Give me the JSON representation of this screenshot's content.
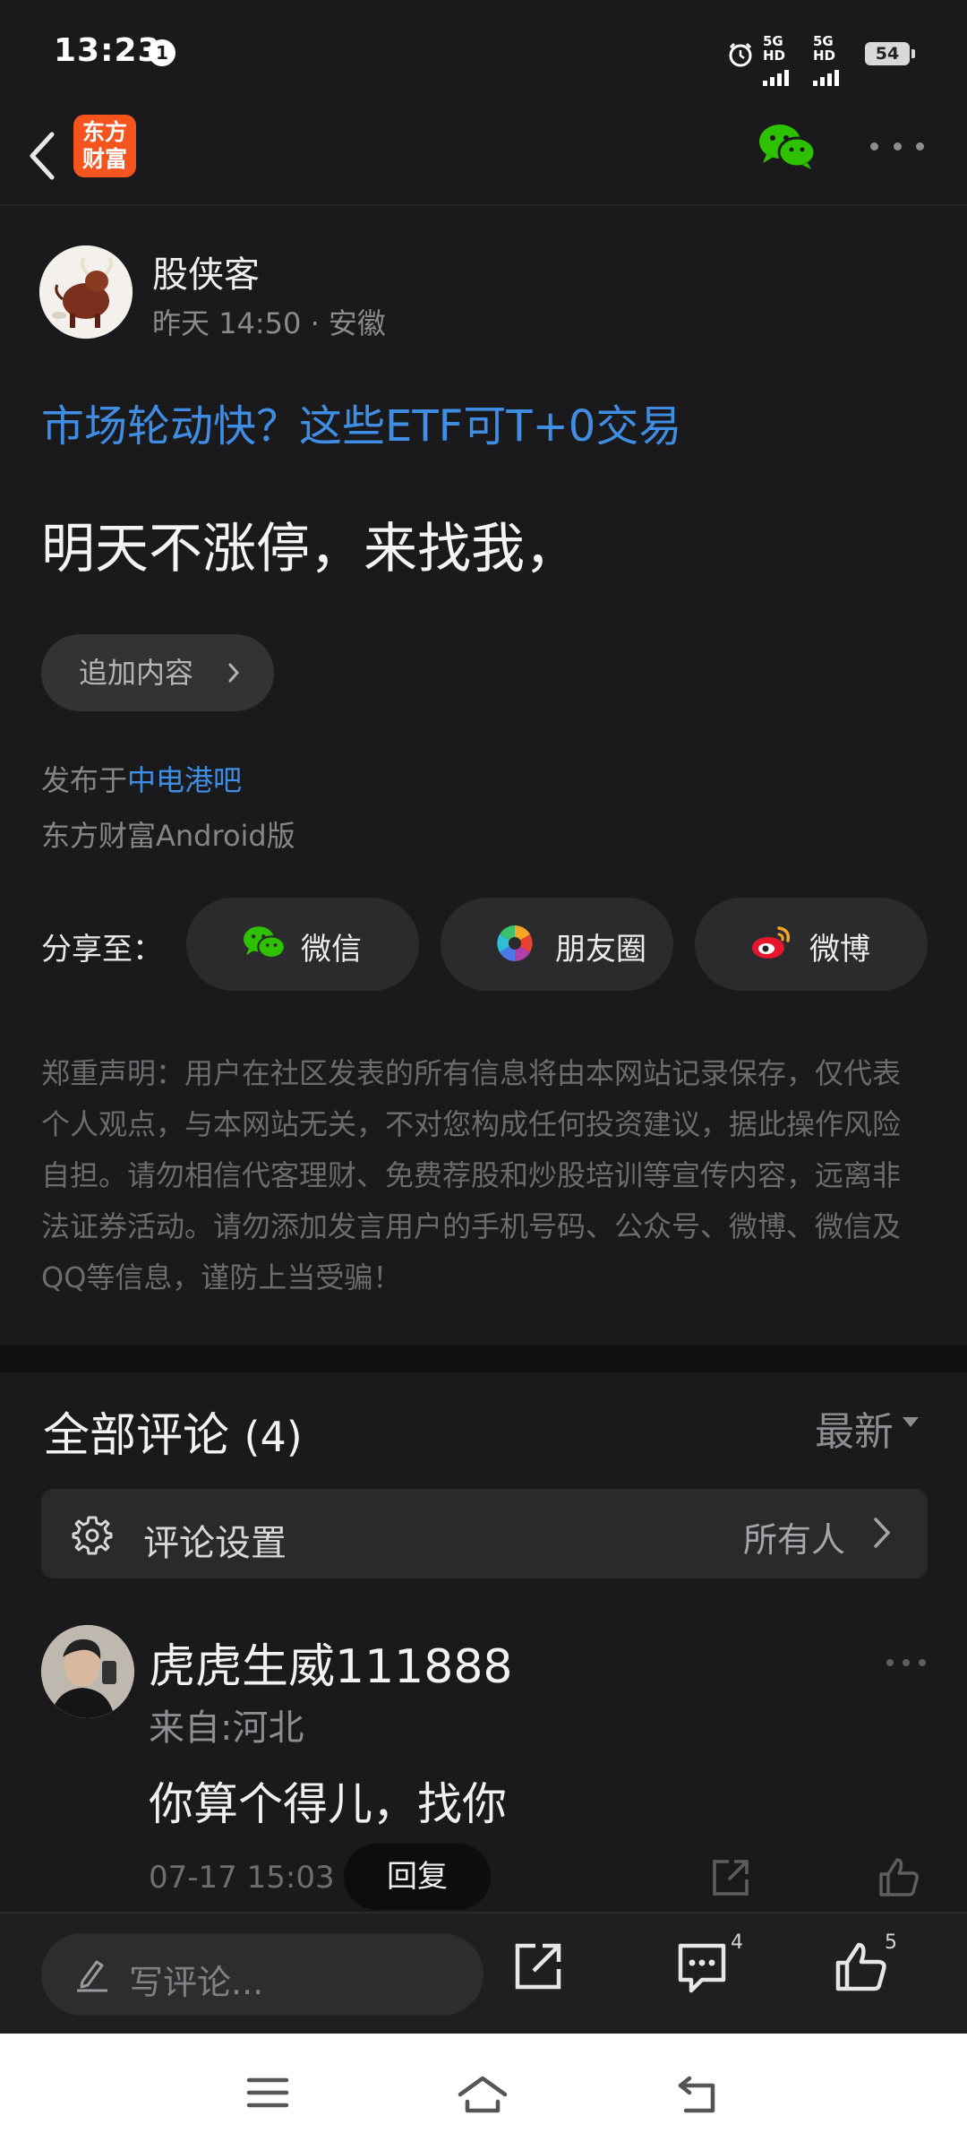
{
  "status_bar": {
    "time": "13:23",
    "notification_count": "1",
    "network_1": "5G HD",
    "network_2": "5G HD",
    "battery": "54"
  },
  "nav": {
    "app_logo_line1": "东方",
    "app_logo_line2": "财富"
  },
  "post": {
    "author_name": "股侠客",
    "author_meta": "昨天 14:50 · 安徽",
    "ad_link": "市场轮动快？这些ETF可T+0交易",
    "content": "明天不涨停，来找我，",
    "append_button": "追加内容",
    "publish_prefix": "发布于",
    "forum_name": "中电港吧",
    "client": "东方财富Android版",
    "share_label": "分享至：",
    "share_options": [
      "微信",
      "朋友圈",
      "微博"
    ],
    "disclaimer": "郑重声明：用户在社区发表的所有信息将由本网站记录保存，仅代表个人观点，与本网站无关，不对您构成任何投资建议，据此操作风险自担。请勿相信代客理财、免费荐股和炒股培训等宣传内容，远离非法证券活动。请勿添加发言用户的手机号码、公众号、微博、微信及QQ等信息，谨防上当受骗！"
  },
  "comments": {
    "title": "全部评论",
    "count": "(4)",
    "sort": "最新",
    "settings_label": "评论设置",
    "settings_value": "所有人",
    "items": [
      {
        "user": "虎虎生威111888",
        "from": "来自:河北",
        "text": "你算个得儿，找你",
        "time": "07-17 15:03",
        "reply": "回复"
      }
    ]
  },
  "bottom_bar": {
    "write_placeholder": "写评论...",
    "comment_count": "4",
    "like_count": "5"
  },
  "colors": {
    "background": "#1a1a1c",
    "link_blue": "#3f8ee3",
    "brand_orange": "#f5541e",
    "wechat_green": "#2dc100"
  }
}
